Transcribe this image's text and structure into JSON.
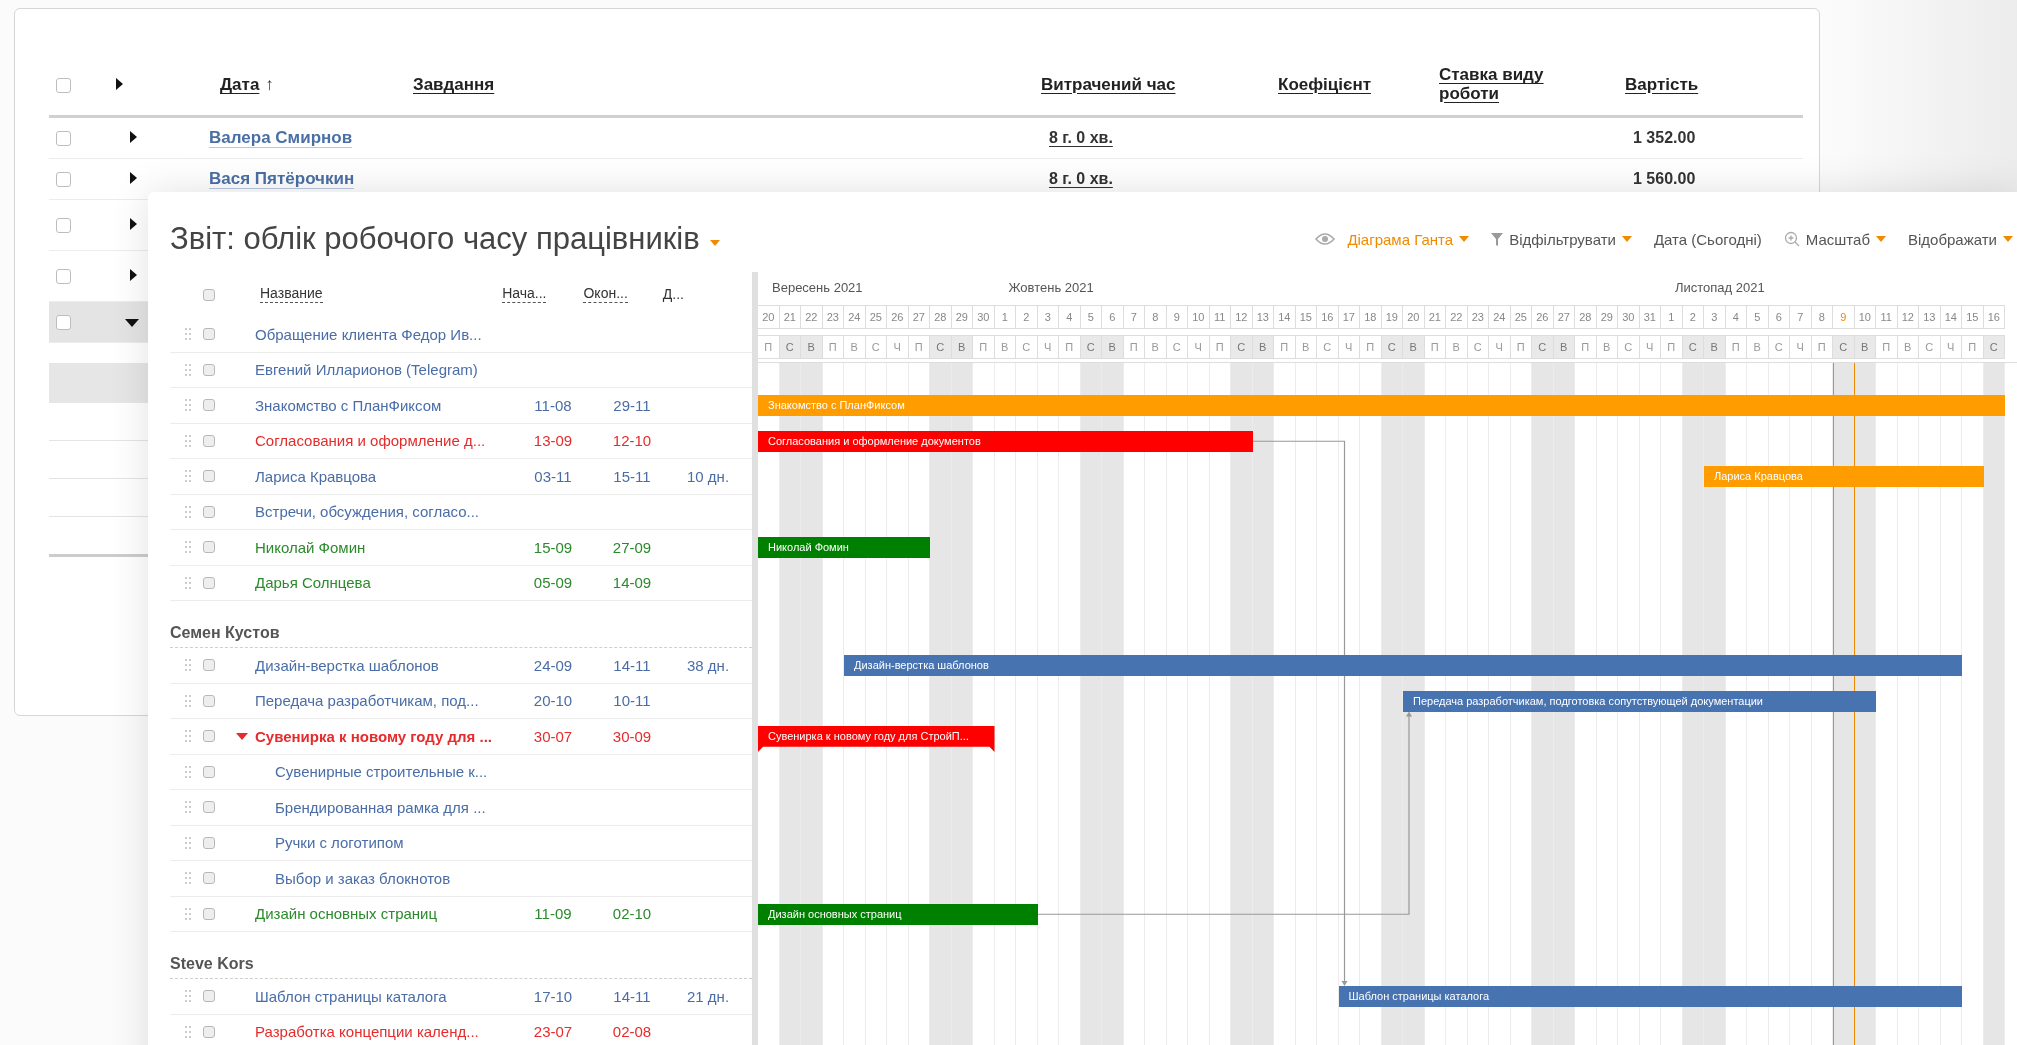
{
  "report_table": {
    "header_checked": false,
    "header_expanded": false,
    "columns": [
      {
        "label": "Дата",
        "sort_mark": "↑"
      },
      {
        "label": "Завдання"
      },
      {
        "label": "Витрачений час"
      },
      {
        "label": "Коефіцієнт"
      },
      {
        "label": "Ставка виду роботи"
      },
      {
        "label": "Вартість"
      }
    ],
    "rows": [
      {
        "name": "Валера Смирнов",
        "time": "8 г. 0 хв.",
        "cost": "1 352.00",
        "checked": false,
        "expanded": false,
        "selected": false
      },
      {
        "name": "Вася Пятёрочкин",
        "time": "8 г. 0 хв.",
        "cost": "1 560.00",
        "checked": false,
        "expanded": false,
        "selected": false
      },
      {
        "checked": false,
        "expanded": false,
        "selected": false
      },
      {
        "checked": false,
        "expanded": false,
        "selected": false
      },
      {
        "checked": false,
        "expanded": true,
        "selected": true
      }
    ]
  },
  "gantt": {
    "title": "Звіт: облік робочого часу працівників",
    "toolbar": [
      {
        "kind": "view",
        "label": "Діаграма Ганта",
        "selected": true,
        "dropdown": true
      },
      {
        "kind": "filter",
        "label": "Відфільтрувати",
        "selected": false,
        "dropdown": true
      },
      {
        "kind": "plain",
        "label": "Дата (Сьогодні)",
        "selected": false,
        "dropdown": false
      },
      {
        "kind": "zoom",
        "label": "Масштаб",
        "selected": false,
        "dropdown": true
      },
      {
        "kind": "plain",
        "label": "Відображати",
        "selected": false,
        "dropdown": true
      }
    ],
    "header_checked": false,
    "columns": [
      "Название",
      "Нача...",
      "Окон...",
      "Д..."
    ],
    "days": [
      {
        "day": "20",
        "weekday": "П",
        "weekend": false,
        "today": false,
        "month": "Вересень 2021"
      },
      {
        "day": "21",
        "weekday": "С",
        "weekend": true,
        "today": false
      },
      {
        "day": "22",
        "weekday": "В",
        "weekend": true,
        "today": false
      },
      {
        "day": "23",
        "weekday": "П",
        "weekend": false,
        "today": false
      },
      {
        "day": "24",
        "weekday": "В",
        "weekend": false,
        "today": false
      },
      {
        "day": "25",
        "weekday": "С",
        "weekend": false,
        "today": false
      },
      {
        "day": "26",
        "weekday": "Ч",
        "weekend": false,
        "today": false
      },
      {
        "day": "27",
        "weekday": "П",
        "weekend": false,
        "today": false
      },
      {
        "day": "28",
        "weekday": "С",
        "weekend": true,
        "today": false
      },
      {
        "day": "29",
        "weekday": "В",
        "weekend": true,
        "today": false
      },
      {
        "day": "30",
        "weekday": "П",
        "weekend": false,
        "today": false
      },
      {
        "day": "1",
        "weekday": "В",
        "weekend": false,
        "today": false,
        "month": "Жовтень 2021"
      },
      {
        "day": "2",
        "weekday": "С",
        "weekend": false,
        "today": false
      },
      {
        "day": "3",
        "weekday": "Ч",
        "weekend": false,
        "today": false
      },
      {
        "day": "4",
        "weekday": "П",
        "weekend": false,
        "today": false
      },
      {
        "day": "5",
        "weekday": "С",
        "weekend": true,
        "today": false
      },
      {
        "day": "6",
        "weekday": "В",
        "weekend": true,
        "today": false
      },
      {
        "day": "7",
        "weekday": "П",
        "weekend": false,
        "today": false
      },
      {
        "day": "8",
        "weekday": "В",
        "weekend": false,
        "today": false
      },
      {
        "day": "9",
        "weekday": "С",
        "weekend": false,
        "today": false
      },
      {
        "day": "10",
        "weekday": "Ч",
        "weekend": false,
        "today": false
      },
      {
        "day": "11",
        "weekday": "П",
        "weekend": false,
        "today": false
      },
      {
        "day": "12",
        "weekday": "С",
        "weekend": true,
        "today": false
      },
      {
        "day": "13",
        "weekday": "В",
        "weekend": true,
        "today": false
      },
      {
        "day": "14",
        "weekday": "П",
        "weekend": false,
        "today": false
      },
      {
        "day": "15",
        "weekday": "В",
        "weekend": false,
        "today": false
      },
      {
        "day": "16",
        "weekday": "С",
        "weekend": false,
        "today": false
      },
      {
        "day": "17",
        "weekday": "Ч",
        "weekend": false,
        "today": false
      },
      {
        "day": "18",
        "weekday": "П",
        "weekend": false,
        "today": false
      },
      {
        "day": "19",
        "weekday": "С",
        "weekend": true,
        "today": false
      },
      {
        "day": "20",
        "weekday": "В",
        "weekend": true,
        "today": false
      },
      {
        "day": "21",
        "weekday": "П",
        "weekend": false,
        "today": false
      },
      {
        "day": "22",
        "weekday": "В",
        "weekend": false,
        "today": false
      },
      {
        "day": "23",
        "weekday": "С",
        "weekend": false,
        "today": false
      },
      {
        "day": "24",
        "weekday": "Ч",
        "weekend": false,
        "today": false
      },
      {
        "day": "25",
        "weekday": "П",
        "weekend": false,
        "today": false
      },
      {
        "day": "26",
        "weekday": "С",
        "weekend": true,
        "today": false
      },
      {
        "day": "27",
        "weekday": "В",
        "weekend": true,
        "today": false
      },
      {
        "day": "28",
        "weekday": "П",
        "weekend": false,
        "today": false
      },
      {
        "day": "29",
        "weekday": "В",
        "weekend": false,
        "today": false
      },
      {
        "day": "30",
        "weekday": "С",
        "weekend": false,
        "today": false
      },
      {
        "day": "31",
        "weekday": "Ч",
        "weekend": false,
        "today": false
      },
      {
        "day": "1",
        "weekday": "П",
        "weekend": false,
        "today": false,
        "month": "Листопад 2021"
      },
      {
        "day": "2",
        "weekday": "С",
        "weekend": true,
        "today": false
      },
      {
        "day": "3",
        "weekday": "В",
        "weekend": true,
        "today": false
      },
      {
        "day": "4",
        "weekday": "П",
        "weekend": false,
        "today": false
      },
      {
        "day": "5",
        "weekday": "В",
        "weekend": false,
        "today": false
      },
      {
        "day": "6",
        "weekday": "С",
        "weekend": false,
        "today": false
      },
      {
        "day": "7",
        "weekday": "Ч",
        "weekend": false,
        "today": false
      },
      {
        "day": "8",
        "weekday": "П",
        "weekend": false,
        "today": false
      },
      {
        "day": "9",
        "weekday": "С",
        "weekend": true,
        "today": true
      },
      {
        "day": "10",
        "weekday": "В",
        "weekend": true,
        "today": false
      },
      {
        "day": "11",
        "weekday": "П",
        "weekend": false,
        "today": false
      },
      {
        "day": "12",
        "weekday": "В",
        "weekend": false,
        "today": false
      },
      {
        "day": "13",
        "weekday": "С",
        "weekend": false,
        "today": false
      },
      {
        "day": "14",
        "weekday": "Ч",
        "weekend": false,
        "today": false
      },
      {
        "day": "15",
        "weekday": "П",
        "weekend": false,
        "today": false
      },
      {
        "day": "16",
        "weekday": "С",
        "weekend": true,
        "today": false
      }
    ],
    "groups": [
      {
        "rows": [
          {
            "title": "Обращение клиента Федор Ив...",
            "color": "#4a6da7",
            "checked": false
          },
          {
            "title": "Евгений Илларионов (Telegram)",
            "color": "#4a6da7",
            "checked": false
          },
          {
            "title": "Знакомство с ПланФиксом",
            "color": "#4a6da7",
            "checked": false,
            "start": "11-08",
            "end": "29-11",
            "bar": {
              "label": "Знакомство с ПланФиксом",
              "color": "#ff9d00",
              "kind": "task"
            }
          },
          {
            "title": "Согласования и оформление д...",
            "color": "#e52b2b",
            "checked": false,
            "start": "13-09",
            "end": "12-10",
            "bar": {
              "label": "Согласования и оформление документов",
              "color": "#ff0000",
              "kind": "task"
            }
          },
          {
            "title": "Лариса Кравцова",
            "color": "#4a6da7",
            "checked": false,
            "start": "03-11",
            "end": "15-11",
            "duration": "10 дн.",
            "bar": {
              "label": "Лариса Кравцова",
              "color": "#ff9d00",
              "kind": "task"
            }
          },
          {
            "title": "Встречи, обсуждения, согласо...",
            "color": "#4a6da7",
            "checked": false
          },
          {
            "title": "Николай Фомин",
            "color": "#2b8a2b",
            "checked": false,
            "start": "15-09",
            "end": "27-09",
            "bar": {
              "label": "Николай Фомин",
              "color": "#008000",
              "kind": "task"
            }
          },
          {
            "title": "Дарья Солнцева",
            "color": "#2b8a2b",
            "checked": false,
            "start": "05-09",
            "end": "14-09"
          }
        ]
      },
      {
        "name": "Семен Кустов",
        "rows": [
          {
            "title": "Дизайн-верстка шаблонов",
            "color": "#4a6da7",
            "checked": false,
            "start": "24-09",
            "end": "14-11",
            "duration": "38 дн.",
            "bar": {
              "label": "Дизайн-верстка шаблонов",
              "color": "#4873b1",
              "kind": "task"
            }
          },
          {
            "title": "Передача разработчикам, под...",
            "color": "#4a6da7",
            "checked": false,
            "start": "20-10",
            "end": "10-11",
            "bar": {
              "label": "Передача разработчикам, подготовка сопутствующей документации",
              "color": "#4873b1",
              "kind": "task"
            }
          },
          {
            "title": "Сувенирка к новому году для ...",
            "color": "#e52b2b",
            "checked": false,
            "start": "30-07",
            "end": "30-09",
            "expanded": true,
            "bar": {
              "label": "Сувенирка к новому году для СтройП...",
              "color": "#ff0000",
              "kind": "summary"
            },
            "children": [
              {
                "title": "Сувенирные строительные к...",
                "color": "#4a6da7",
                "checked": false
              },
              {
                "title": "Брендированная рамка для ...",
                "color": "#4a6da7",
                "checked": false
              },
              {
                "title": "Ручки с логотипом",
                "color": "#4a6da7",
                "checked": false
              },
              {
                "title": "Выбор и заказ блокнотов",
                "color": "#4a6da7",
                "checked": false
              }
            ]
          },
          {
            "title": "Дизайн основных страниц",
            "color": "#2b8a2b",
            "checked": false,
            "start": "11-09",
            "end": "02-10",
            "bar": {
              "label": "Дизайн основных страниц",
              "color": "#008000",
              "kind": "task"
            }
          }
        ]
      },
      {
        "name": "Steve Kors",
        "rows": [
          {
            "title": "Шаблон страницы каталога",
            "color": "#4a6da7",
            "checked": false,
            "start": "17-10",
            "end": "14-11",
            "duration": "21 дн.",
            "bar": {
              "label": "Шаблон страницы каталога",
              "color": "#4873b1",
              "kind": "task"
            }
          },
          {
            "title": "Разработка концепции календ...",
            "color": "#e52b2b",
            "checked": false,
            "start": "23-07",
            "end": "02-08"
          }
        ]
      }
    ]
  }
}
